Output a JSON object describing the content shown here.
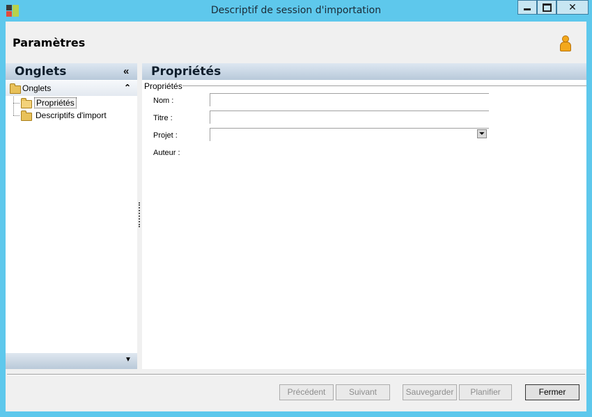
{
  "window": {
    "title": "Descriptif de session d'importation",
    "controls": {
      "minimize": "minimize",
      "maximize": "maximize",
      "close": "✕"
    }
  },
  "header": {
    "title": "Paramètres",
    "icon": "user-icon"
  },
  "left_panel": {
    "title": "Onglets",
    "collapse_glyph": "«",
    "group": {
      "label": "Onglets",
      "expand_glyph": "⌃"
    },
    "items": [
      {
        "label": "Propriétés",
        "selected": true
      },
      {
        "label": "Descriptifs d'import",
        "selected": false
      }
    ],
    "footer_glyph": "▼"
  },
  "right_panel": {
    "title": "Propriétés",
    "section_label": "Propriétés",
    "fields": [
      {
        "label": "Nom :",
        "value": ""
      },
      {
        "label": "Titre :",
        "value": ""
      },
      {
        "label": "Projet :",
        "value": ""
      },
      {
        "label": "Auteur :",
        "value": ""
      }
    ],
    "dropdown_glyph": "⏷"
  },
  "footer": {
    "buttons": {
      "previous": "Précédent",
      "next": "Suivant",
      "save": "Sauvegarder",
      "schedule": "Planifier",
      "close": "Fermer"
    }
  }
}
